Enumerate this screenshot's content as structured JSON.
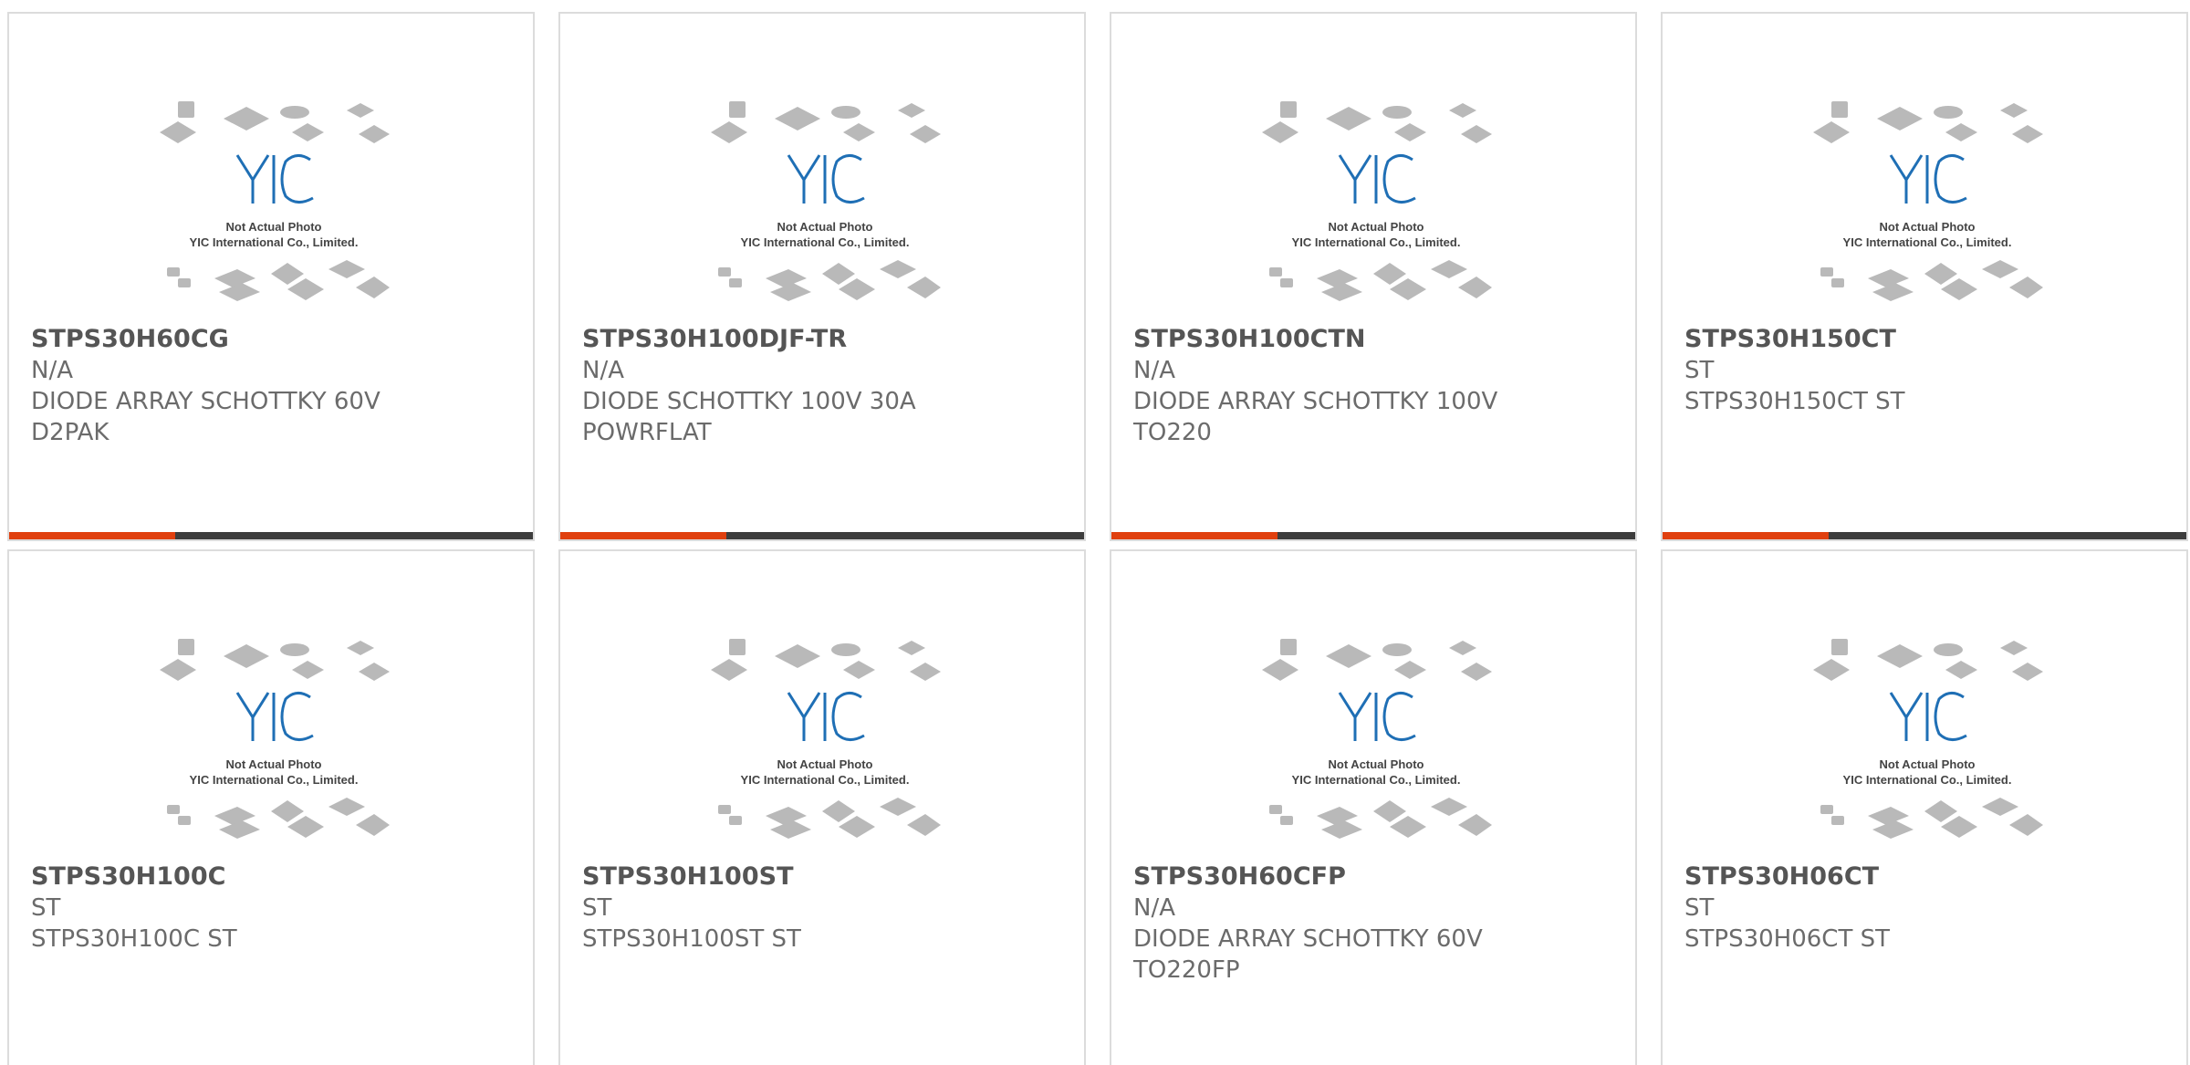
{
  "placeholder": {
    "caption_line1": "Not Actual Photo",
    "caption_line2": "YIC International Co., Limited.",
    "logo_text": "YIC"
  },
  "colors": {
    "accent": "#e0400f",
    "bar": "#3d3d3d",
    "logo_blue": "#1f6fb5"
  },
  "products": [
    {
      "part": "STPS30H60CG",
      "manufacturer": "N/A",
      "desc1": "DIODE ARRAY SCHOTTKY 60V",
      "desc2": "D2PAK"
    },
    {
      "part": "STPS30H100DJF-TR",
      "manufacturer": "N/A",
      "desc1": "DIODE SCHOTTKY 100V 30A",
      "desc2": "POWRFLAT"
    },
    {
      "part": "STPS30H100CTN",
      "manufacturer": "N/A",
      "desc1": "DIODE ARRAY SCHOTTKY 100V",
      "desc2": "TO220"
    },
    {
      "part": "STPS30H150CT",
      "manufacturer": "ST",
      "desc1": "STPS30H150CT ST",
      "desc2": ""
    },
    {
      "part": "STPS30H100C",
      "manufacturer": "ST",
      "desc1": "STPS30H100C ST",
      "desc2": ""
    },
    {
      "part": "STPS30H100ST",
      "manufacturer": "ST",
      "desc1": "STPS30H100ST ST",
      "desc2": ""
    },
    {
      "part": "STPS30H60CFP",
      "manufacturer": "N/A",
      "desc1": "DIODE ARRAY SCHOTTKY 60V",
      "desc2": "TO220FP"
    },
    {
      "part": "STPS30H06CT",
      "manufacturer": "ST",
      "desc1": "STPS30H06CT ST",
      "desc2": ""
    }
  ]
}
